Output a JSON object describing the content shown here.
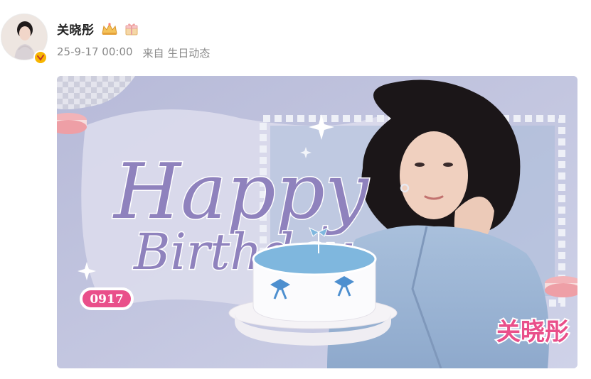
{
  "post": {
    "author": {
      "name": "关晓彤",
      "badges": [
        "crown-icon",
        "gift-icon"
      ],
      "verified_color": "#f7b500"
    },
    "meta": {
      "timestamp": "25-9-17 00:00",
      "source": "来自 生日动态"
    },
    "image": {
      "greeting_line1": "Happy",
      "greeting_line2": "Birthday",
      "date_tag": "0917",
      "name_tag": "关晓彤",
      "palette": {
        "background": "#c9cbe2",
        "script": "#8f82bd",
        "accent_pink": "#e94f8a",
        "cake_blue": "#7fb7de"
      }
    }
  }
}
